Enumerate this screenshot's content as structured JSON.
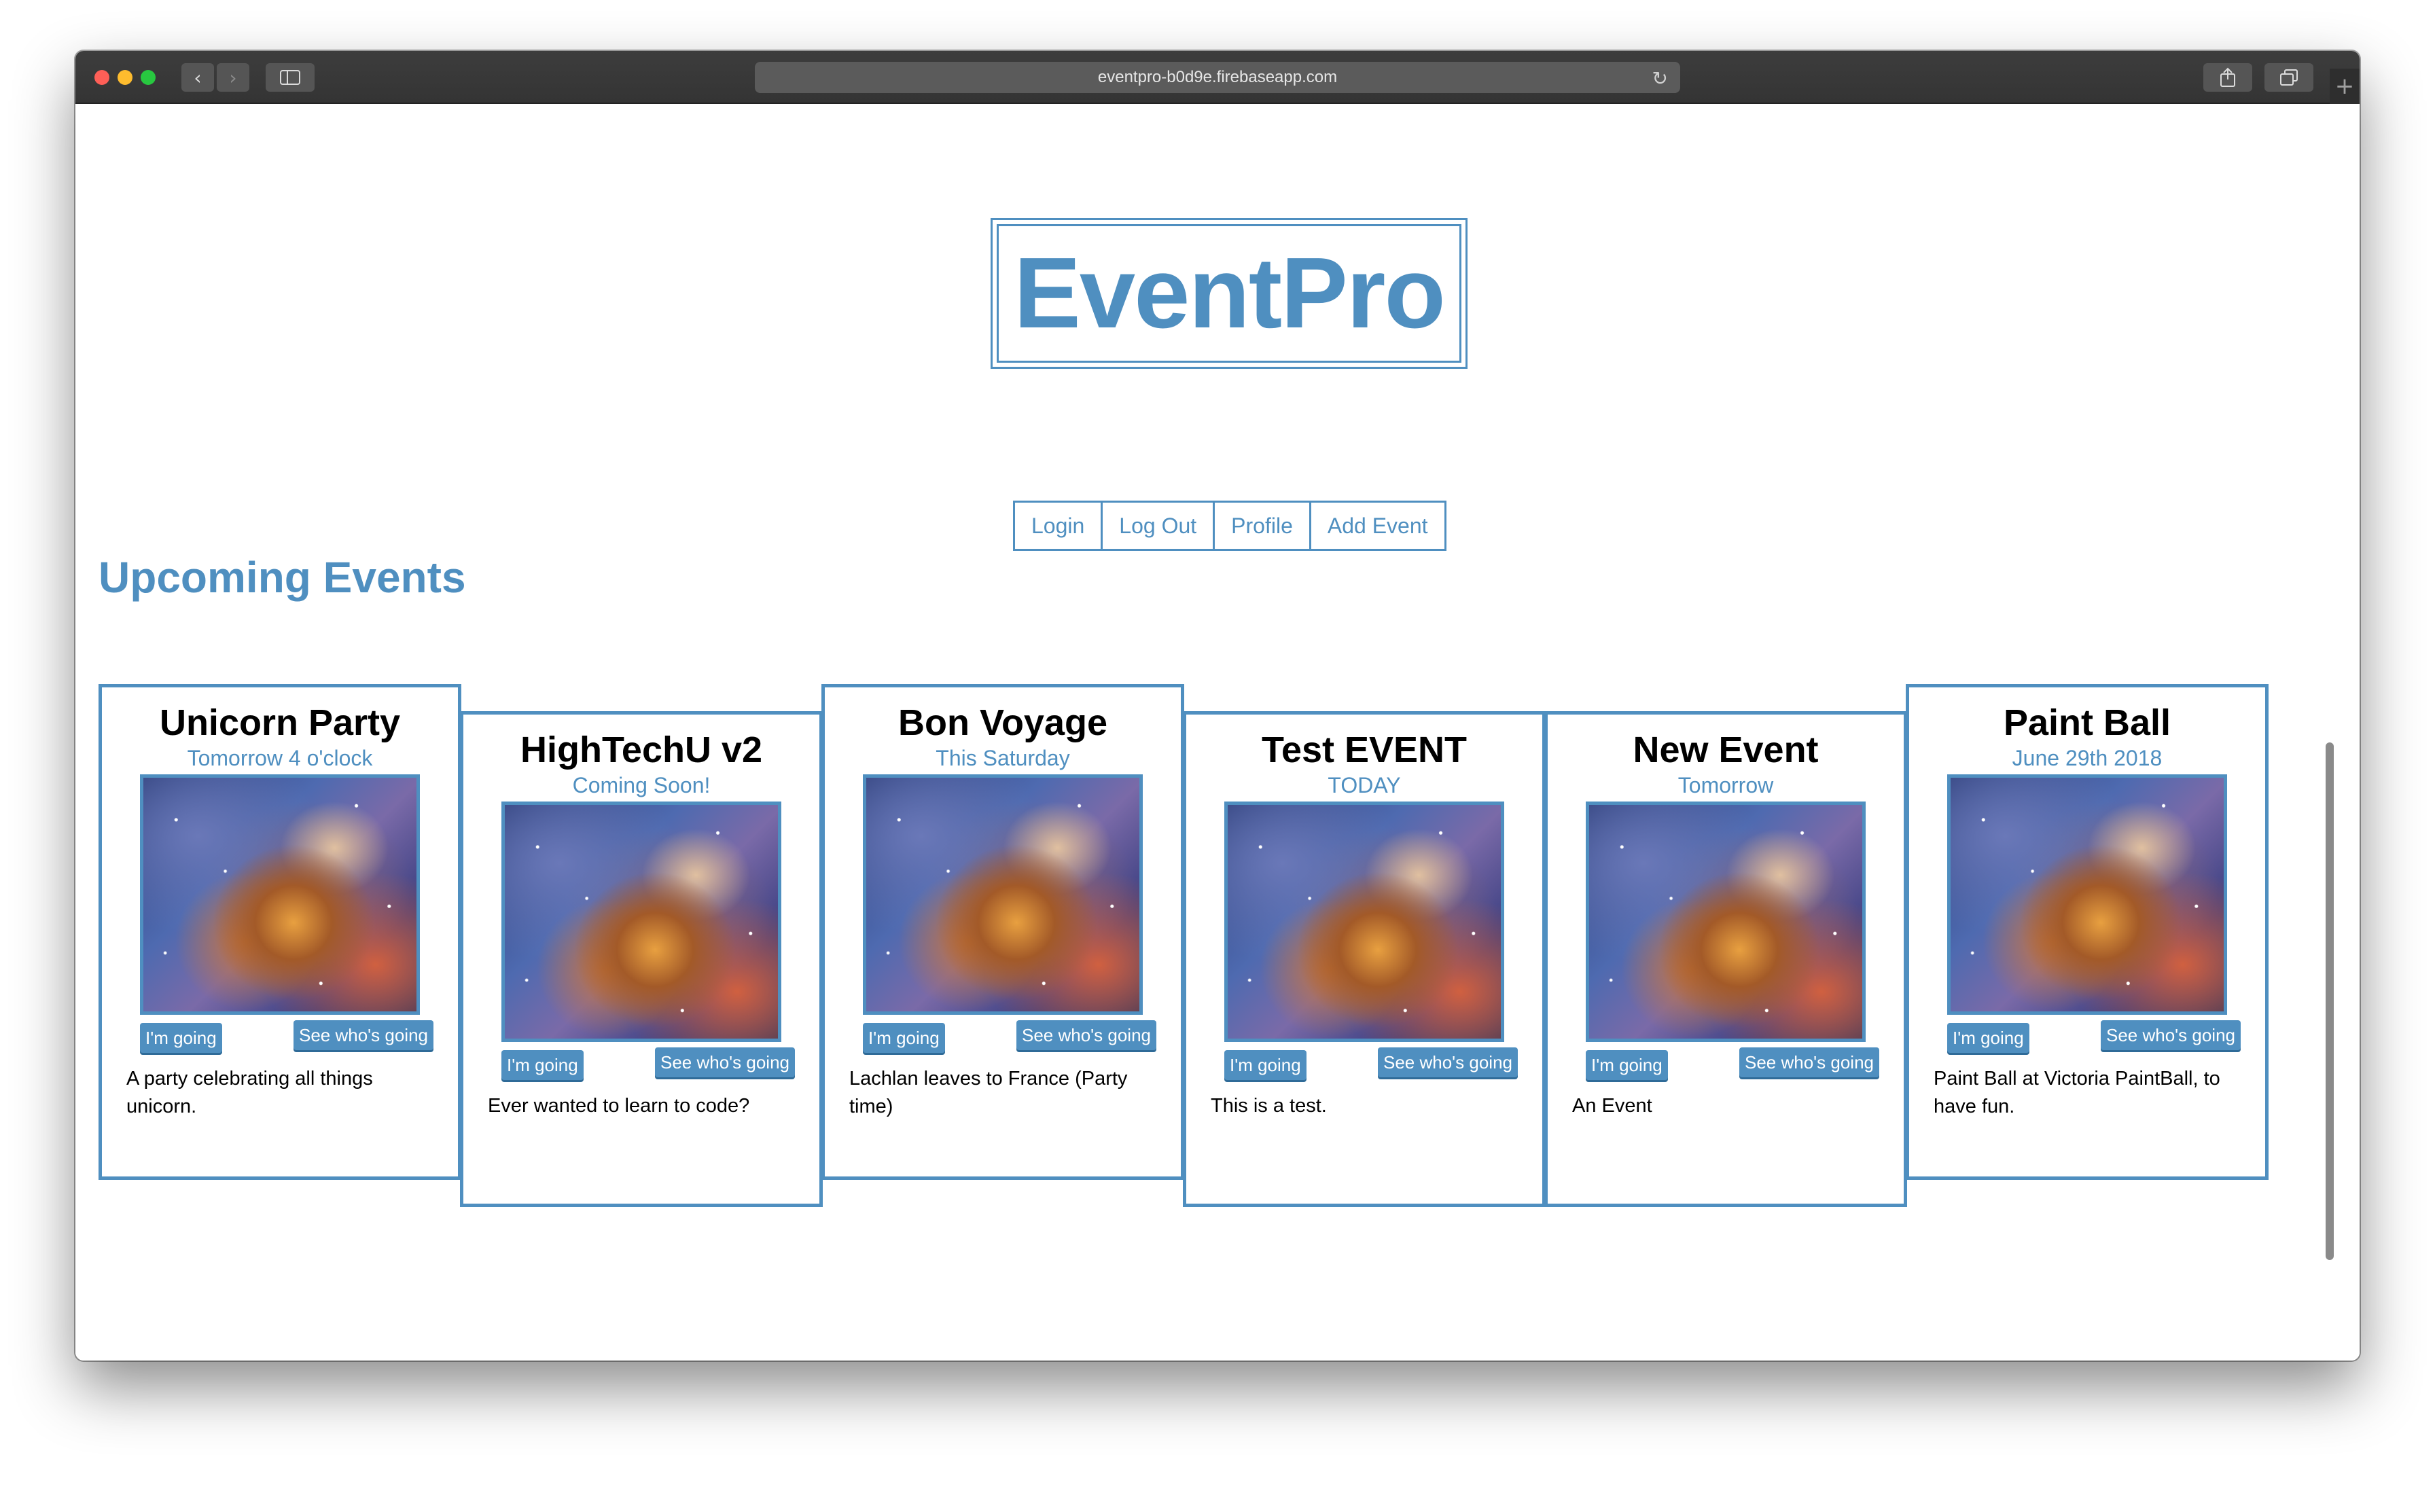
{
  "browser": {
    "url": "eventpro-b0d9e.firebaseapp.com"
  },
  "app": {
    "logo": "EventPro"
  },
  "nav": {
    "items": [
      "Login",
      "Log Out",
      "Profile",
      "Add Event"
    ]
  },
  "section_title": "Upcoming Events",
  "events": [
    {
      "title": "Unicorn Party",
      "date": "Tomorrow 4 o'clock",
      "going_label": "I'm going",
      "see_label": "See who's going",
      "description": "A party celebrating all things unicorn."
    },
    {
      "title": "HighTechU v2",
      "date": "Coming Soon!",
      "going_label": "I'm going",
      "see_label": "See who's going",
      "description": "Ever wanted to learn to code?"
    },
    {
      "title": "Bon Voyage",
      "date": "This Saturday",
      "going_label": "I'm going",
      "see_label": "See who's going",
      "description": "Lachlan leaves to France (Party time)"
    },
    {
      "title": "Test EVENT",
      "date": "TODAY",
      "going_label": "I'm going",
      "see_label": "See who's going",
      "description": "This is a test."
    },
    {
      "title": "New Event",
      "date": "Tomorrow",
      "going_label": "I'm going",
      "see_label": "See who's going",
      "description": "An Event"
    },
    {
      "title": "Paint Ball",
      "date": "June 29th 2018",
      "going_label": "I'm going",
      "see_label": "See who's going",
      "description": "Paint Ball at Victoria PaintBall, to have fun."
    }
  ],
  "colors": {
    "accent": "#4f8fc0"
  },
  "icons": {
    "back": "chevron-left-icon",
    "forward": "chevron-right-icon",
    "sidebar": "sidebar-icon",
    "reload": "reload-icon",
    "share": "share-icon",
    "tabs": "tabs-icon",
    "new_tab": "plus-icon"
  }
}
